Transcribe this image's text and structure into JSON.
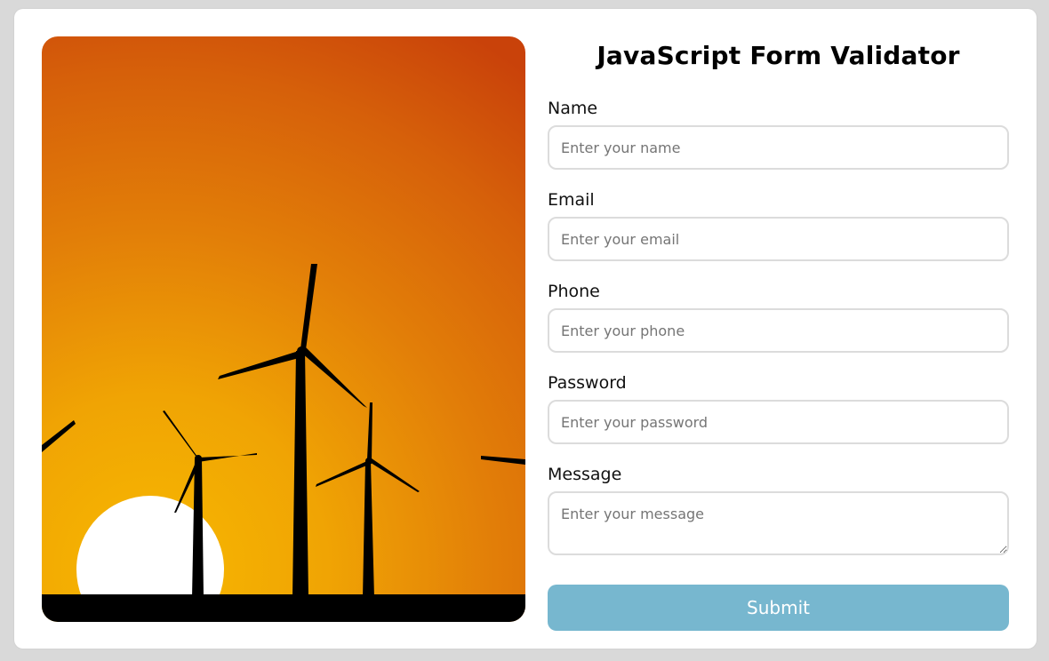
{
  "form": {
    "title": "JavaScript Form Validator",
    "fields": [
      {
        "label": "Name",
        "placeholder": "Enter your name",
        "value": ""
      },
      {
        "label": "Email",
        "placeholder": "Enter your email",
        "value": ""
      },
      {
        "label": "Phone",
        "placeholder": "Enter your phone",
        "value": ""
      },
      {
        "label": "Password",
        "placeholder": "Enter your password",
        "value": ""
      },
      {
        "label": "Message",
        "placeholder": "Enter your message",
        "value": ""
      }
    ],
    "submit_label": "Submit"
  },
  "colors": {
    "page_background": "#d9d9d9",
    "card_background": "#ffffff",
    "input_border": "#dcdcdc",
    "submit_background": "#77b7cf",
    "submit_text": "#ffffff",
    "sky_top": "#c9420a",
    "sky_glow": "#f7b800",
    "sun": "#ffffff",
    "silhouette": "#000000"
  },
  "icons": [
    "wind-turbine-illustration",
    "textarea-resize-handle-icon"
  ]
}
